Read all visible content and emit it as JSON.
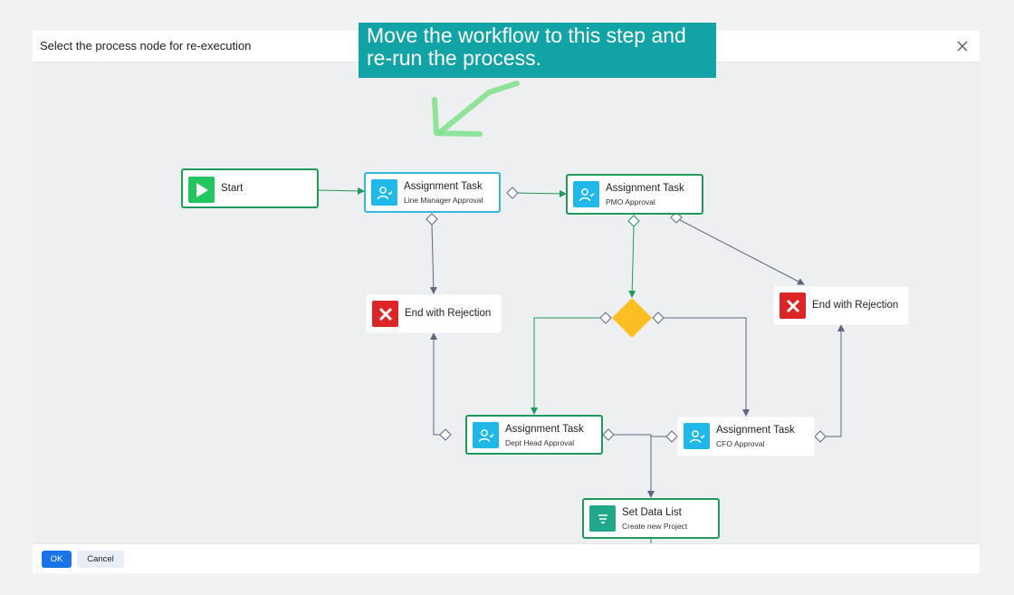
{
  "dialog": {
    "title": "Select the process node for re-execution"
  },
  "nodes": {
    "start": {
      "label": "Start"
    },
    "line_manager": {
      "title": "Assignment Task",
      "subtitle": "Line Manager Approval"
    },
    "pmo": {
      "title": "Assignment Task",
      "subtitle": "PMO Approval"
    },
    "end_rejection_left": {
      "label": "End with Rejection"
    },
    "end_rejection_right": {
      "label": "End with Rejection"
    },
    "dept_head": {
      "title": "Assignment Task",
      "subtitle": "Dept Head Approval"
    },
    "cfo": {
      "title": "Assignment Task",
      "subtitle": "CFO Approval"
    },
    "set_data_list": {
      "title": "Set Data List",
      "subtitle": "Create new Project"
    }
  },
  "zoom": {
    "zoom_in": "+",
    "zoom_out": "−",
    "fit": "fit-screen-icon"
  },
  "footer": {
    "ok_label": "OK",
    "cancel_label": "Cancel"
  },
  "callout": {
    "text": "Move the workflow to this step and re-run the process."
  },
  "colors": {
    "accent_blue": "#1a73e8",
    "node_green": "#1f9a5a",
    "selected_blue": "#33b7e0",
    "gateway": "#fbbf24",
    "callout_teal": "#12a3a6",
    "annotation_arrow": "#7ee08a"
  },
  "icons": {
    "task": "assignment-user-icon",
    "start": "play-icon",
    "end": "x-icon",
    "data": "data-list-icon",
    "close": "close-icon"
  }
}
